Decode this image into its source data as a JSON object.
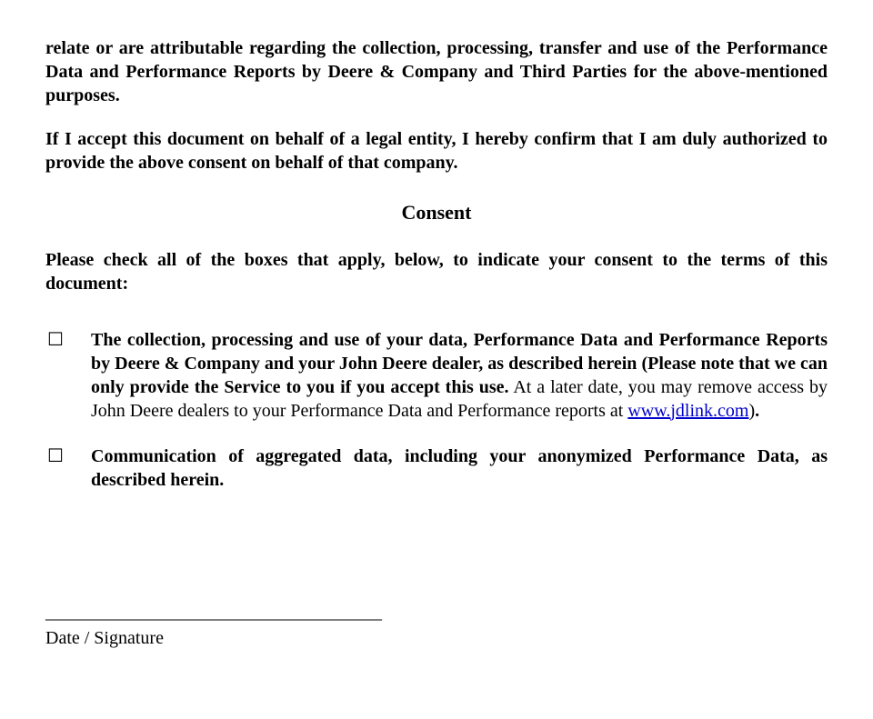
{
  "para1": "relate or are attributable regarding the collection, processing, transfer and use of the Performance Data and Performance Reports by Deere & Company and Third Parties for the above-mentioned purposes.",
  "para2": "If I accept this document on behalf of a legal entity, I hereby confirm that I am duly authorized to provide the above consent on behalf of that company.",
  "consentHeading": "Consent",
  "consentIntro": "Please check all of the boxes that apply, below, to indicate your consent to the terms of this document:",
  "checkboxGlyph": "☐",
  "item1": {
    "boldA": "The collection, processing and use of your data, Performance Data and Performance Reports by Deere & Company and your John Deere dealer, as described herein (Please note that we can only provide the Service to you if you accept this use.",
    "plain": " At a later date, you may remove access by John Deere dealers to your Performance Data and Performance reports at ",
    "link": "www.jdlink.com",
    "afterLink": ")",
    "period": "."
  },
  "item2": "Communication of aggregated data, including your anonymized Performance Data, as described herein.",
  "sigLine": "_____________________________________",
  "sigLabel": "Date / Signature"
}
